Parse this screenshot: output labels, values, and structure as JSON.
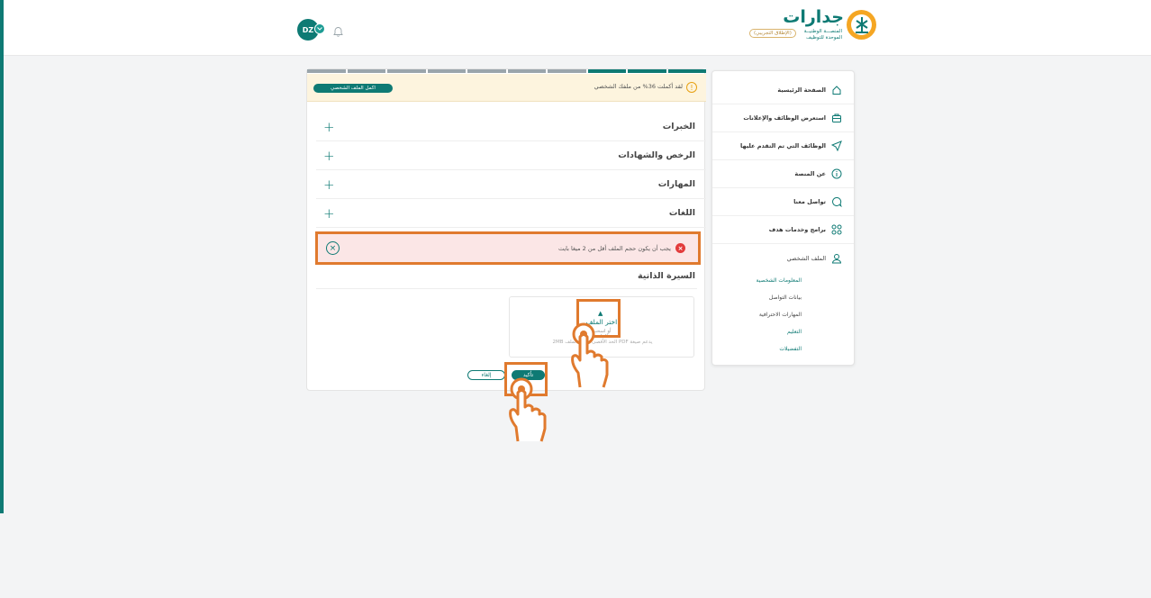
{
  "header": {
    "avatar_initials": "DZ",
    "logo_name": "جدارات",
    "logo_sub1": "المنصـــة الوطنيــة",
    "logo_sub2": "الموحدة للتوظيف",
    "logo_badge": "(الإطلاق التجريبي)"
  },
  "progress": {
    "segments_total": 10,
    "segments_done": 3
  },
  "banner": {
    "text": "لقد أكملت 36% من ملفك الشخصي",
    "button": "اكمل الملف الشخصي"
  },
  "sections": [
    {
      "title": "الخبرات"
    },
    {
      "title": "الرخص والشهادات"
    },
    {
      "title": "المهارات"
    },
    {
      "title": "اللغات"
    }
  ],
  "error": {
    "text": "يجب أن يكون حجم الملف أقل من 2 ميغا بايت"
  },
  "cv": {
    "title": "السيرة الذاتية",
    "upload_label": "اختر الملف",
    "upload_sub": "أو اسحب الملف",
    "upload_hint": "يدعم صيغة PDF الحد الأقصى لحجم الملف 2MB"
  },
  "actions": {
    "confirm": "تأكيد",
    "cancel": "إلغاء"
  },
  "sidebar": {
    "items": [
      {
        "label": "الصفحة الرئيسية",
        "icon": "home-icon"
      },
      {
        "label": "استعرض الوظائف والإعلانات",
        "icon": "briefcase-icon"
      },
      {
        "label": "الوظائف التي تم التقدم عليها",
        "icon": "send-icon"
      },
      {
        "label": "عن المنصة",
        "icon": "info-icon"
      },
      {
        "label": "تواصل معنا",
        "icon": "chat-icon"
      },
      {
        "label": "برامج وخدمات هدف",
        "icon": "grid-icon"
      },
      {
        "label": "الملف الشخصي",
        "icon": "user-icon"
      }
    ],
    "sub_items": [
      {
        "label": "المعلومات الشخصية"
      },
      {
        "label": "بيانات التواصل"
      },
      {
        "label": "المهارات الاحترافية"
      },
      {
        "label": "التعليم"
      },
      {
        "label": "التفضيلات"
      }
    ]
  },
  "colors": {
    "brand": "#0e7a74",
    "highlight": "#e07a2e",
    "error_bg": "#fbe6e6",
    "banner_bg": "#fdf4de"
  }
}
